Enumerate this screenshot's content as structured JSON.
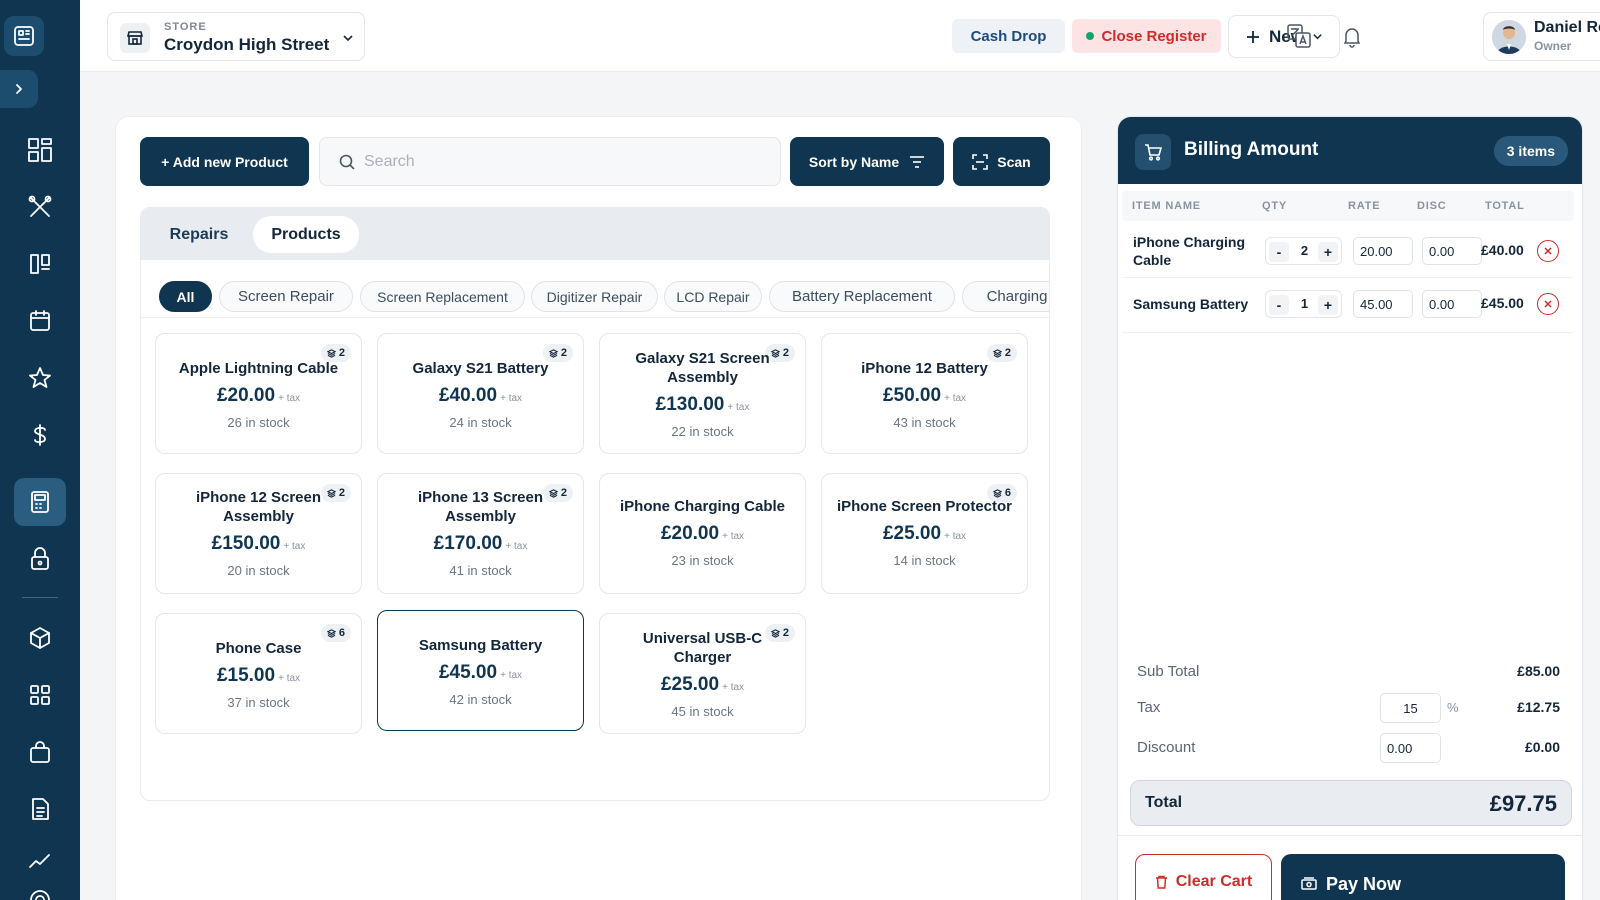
{
  "header": {
    "store_label": "STORE",
    "store_name": "Croydon High Street",
    "cash_drop": "Cash Drop",
    "close_register": "Close Register",
    "new_label": "New",
    "user_name": "Daniel Reid",
    "user_role": "Owner"
  },
  "toolbar": {
    "add_product": "+ Add new Product",
    "search_placeholder": "Search",
    "sort_label": "Sort by Name",
    "scan_label": "Scan"
  },
  "tabs": [
    "Repairs",
    "Products"
  ],
  "active_tab": "Products",
  "categories": [
    "All",
    "Screen Repair",
    "Screen Replacement",
    "Digitizer Repair",
    "LCD Repair",
    "Battery Replacement",
    "Charging"
  ],
  "products": [
    {
      "name": "Apple Lightning Cable",
      "price": "£20.00",
      "tax": "+ tax",
      "stock": "26 in stock",
      "badge": "2"
    },
    {
      "name": "Galaxy S21 Battery",
      "price": "£40.00",
      "tax": "+ tax",
      "stock": "24 in stock",
      "badge": "2"
    },
    {
      "name": "Galaxy S21 Screen Assembly",
      "price": "£130.00",
      "tax": "+ tax",
      "stock": "22 in stock",
      "badge": "2"
    },
    {
      "name": "iPhone 12 Battery",
      "price": "£50.00",
      "tax": "+ tax",
      "stock": "43 in stock",
      "badge": "2"
    },
    {
      "name": "iPhone 12 Screen Assembly",
      "price": "£150.00",
      "tax": "+ tax",
      "stock": "20 in stock",
      "badge": "2"
    },
    {
      "name": "iPhone 13 Screen Assembly",
      "price": "£170.00",
      "tax": "+ tax",
      "stock": "41 in stock",
      "badge": "2"
    },
    {
      "name": "iPhone Charging Cable",
      "price": "£20.00",
      "tax": "+ tax",
      "stock": "23 in stock",
      "badge": ""
    },
    {
      "name": "iPhone Screen Protector",
      "price": "£25.00",
      "tax": "+ tax",
      "stock": "14 in stock",
      "badge": "6"
    },
    {
      "name": "Phone Case",
      "price": "£15.00",
      "tax": "+ tax",
      "stock": "37 in stock",
      "badge": "6"
    },
    {
      "name": "Samsung Battery",
      "price": "£45.00",
      "tax": "+ tax",
      "stock": "42 in stock",
      "badge": ""
    },
    {
      "name": "Universal USB-C Charger",
      "price": "£25.00",
      "tax": "+ tax",
      "stock": "45 in stock",
      "badge": "2"
    }
  ],
  "billing": {
    "title": "Billing Amount",
    "count": "3 items",
    "columns": [
      "ITEM NAME",
      "QTY",
      "RATE",
      "DISC",
      "TOTAL"
    ],
    "items": [
      {
        "name": "iPhone Charging Cable",
        "qty": "2",
        "rate": "20.00",
        "disc": "0.00",
        "total": "£40.00"
      },
      {
        "name": "Samsung Battery",
        "qty": "1",
        "rate": "45.00",
        "disc": "0.00",
        "total": "£45.00"
      }
    ],
    "sub_total_label": "Sub Total",
    "sub_total": "£85.00",
    "tax_label": "Tax",
    "tax_rate": "15",
    "tax_unit": "%",
    "tax_amount": "£12.75",
    "discount_label": "Discount",
    "discount_input": "0.00",
    "discount_amount": "£0.00",
    "total_label": "Total",
    "total": "£97.75",
    "clear_cart": "Clear Cart",
    "pay_now": "Pay Now"
  },
  "icons": {
    "sidebar": [
      "dashboard-icon",
      "repair-tools-icon",
      "kanban-icon",
      "calendar-icon",
      "star-icon",
      "dollar-icon",
      "pos-terminal-icon",
      "lock-icon",
      "box-icon",
      "grid-icon",
      "bag-icon",
      "document-icon",
      "chart-icon",
      "support-icon"
    ]
  },
  "colors": {
    "primary": "#0f3550",
    "danger": "#d02b2b",
    "success": "#16a36b"
  }
}
